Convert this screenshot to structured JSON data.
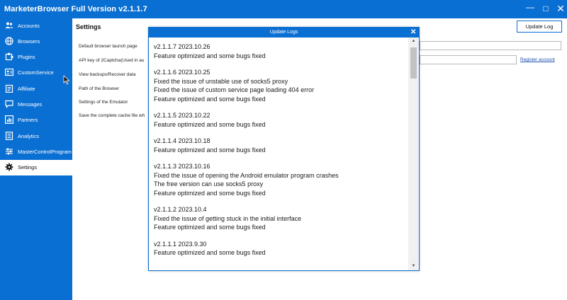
{
  "window": {
    "title": "MarketerBrowser Full Version v2.1.1.7",
    "minimize_glyph": "—",
    "maximize_glyph": "□",
    "close_glyph": "✕"
  },
  "sidebar": {
    "items": [
      {
        "label": "Accounts",
        "icon": "users-icon"
      },
      {
        "label": "Browsers",
        "icon": "globe-icon"
      },
      {
        "label": "Plugins",
        "icon": "puzzle-icon"
      },
      {
        "label": "CustomService",
        "icon": "support-card-icon"
      },
      {
        "label": "Affiliate",
        "icon": "clipboard-icon"
      },
      {
        "label": "Messages",
        "icon": "chat-icon"
      },
      {
        "label": "Partners",
        "icon": "bar-chart-icon"
      },
      {
        "label": "Analytics",
        "icon": "document-icon"
      },
      {
        "label": "MasterControlProgram",
        "icon": "sliders-icon"
      },
      {
        "label": "Settings",
        "icon": "gear-icon"
      }
    ],
    "active_item": "Settings"
  },
  "main": {
    "title": "Settings",
    "update_log_button": "Update Log",
    "settings_labels": [
      "Default browser launch page",
      "API key of 2Captcha(Used in au",
      "View backups/Recover data",
      "Path of the Browser",
      "Settings of the Emulator",
      "Save the complete cache file wh"
    ],
    "register_link": "Register account"
  },
  "modal": {
    "title": "Update Logs",
    "close_glyph": "✕",
    "entries": [
      {
        "version": "v2.1.1.7  2023.10.26",
        "lines": [
          "Feature optimized and some bugs fixed"
        ]
      },
      {
        "version": "v2.1.1.6  2023.10.25",
        "lines": [
          "Fixed the issue of unstable use of socks5 proxy",
          "Fixed the issue of custom service page loading 404 error",
          "Feature optimized and some bugs fixed"
        ]
      },
      {
        "version": "v2.1.1.5  2023.10.22",
        "lines": [
          "Feature optimized and some bugs fixed"
        ]
      },
      {
        "version": "v2.1.1.4  2023.10.18",
        "lines": [
          "Feature optimized and some bugs fixed"
        ]
      },
      {
        "version": "v2.1.1.3  2023.10.16",
        "lines": [
          "Fixed the issue of opening the Android emulator program crashes",
          "The free version can use socks5 proxy",
          "Feature optimized and some bugs fixed"
        ]
      },
      {
        "version": "v2.1.1.2  2023.10.4",
        "lines": [
          "Fixed the issue of getting stuck in the initial interface",
          "Feature optimized and some bugs fixed"
        ]
      },
      {
        "version": "v2.1.1.1  2023.9.30",
        "lines": [
          "Feature optimized and some bugs fixed"
        ]
      }
    ],
    "scroll_up_glyph": "▲",
    "scroll_down_glyph": "▼"
  },
  "colors": {
    "accent": "#0a6fd2",
    "link": "#1f4db0"
  }
}
